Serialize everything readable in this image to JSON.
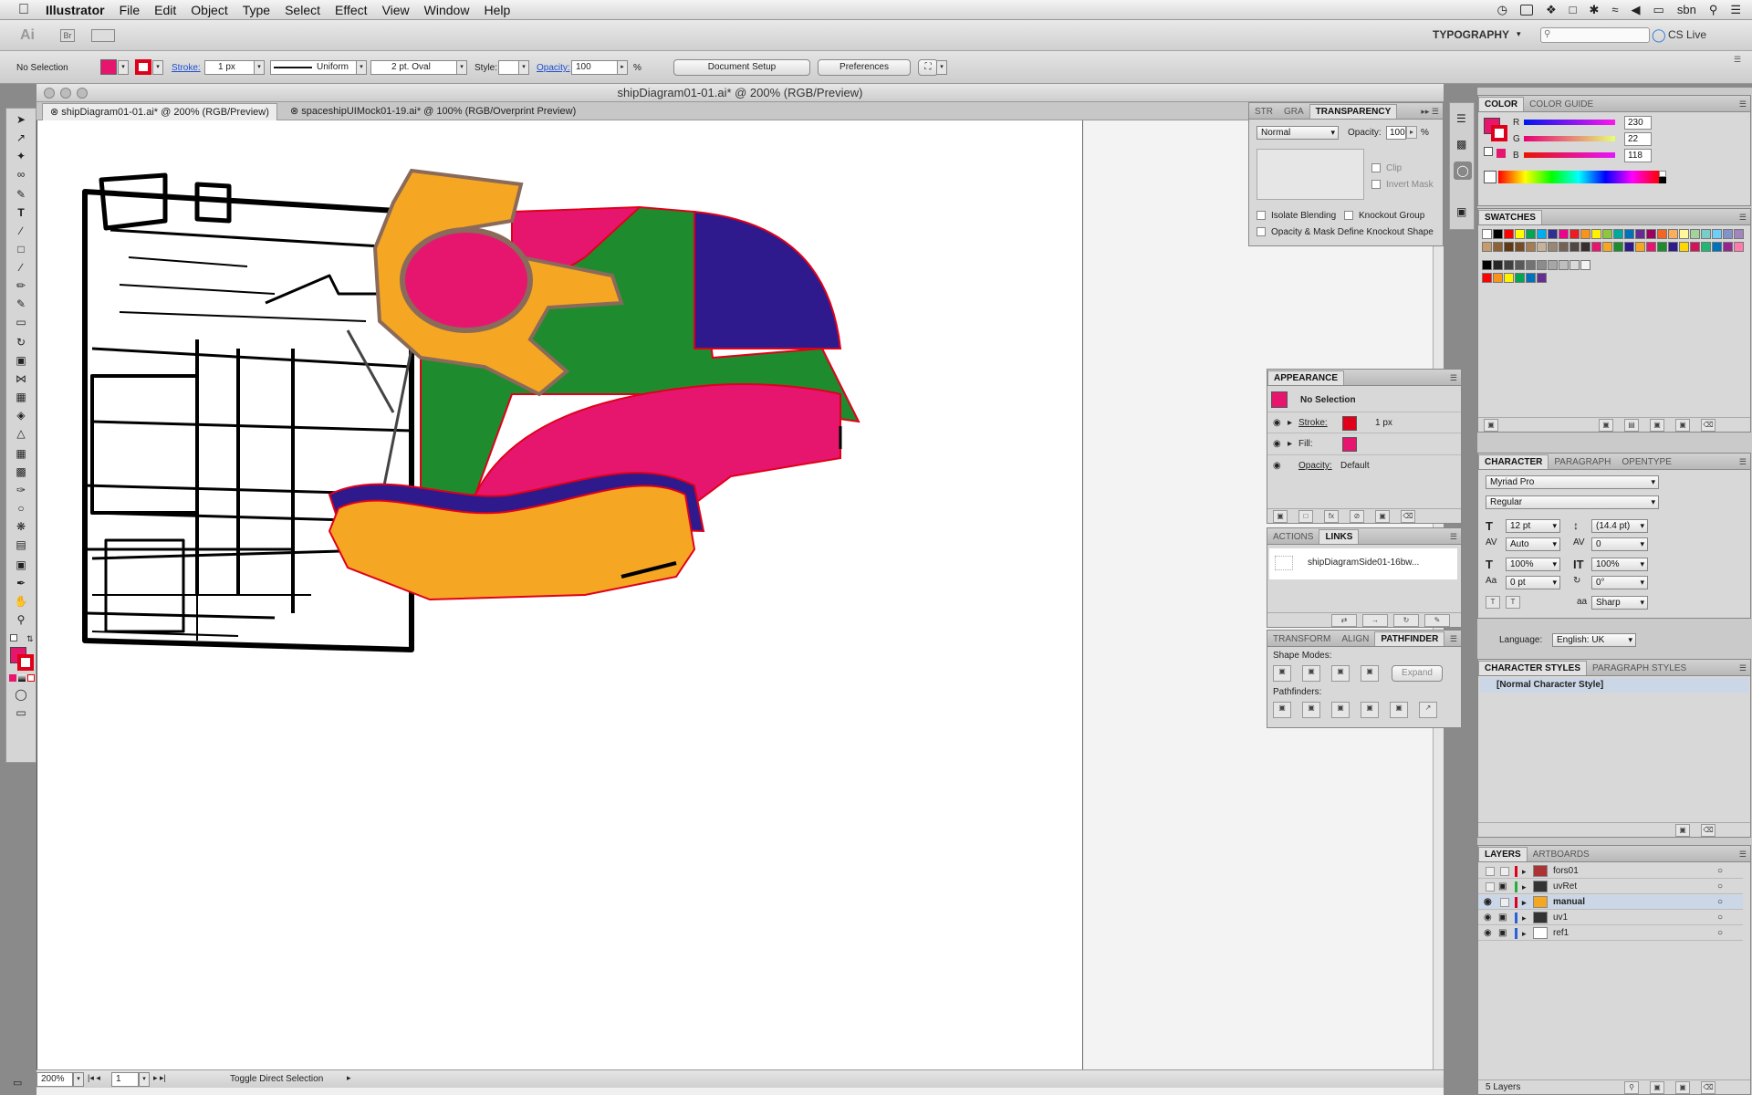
{
  "menubar": {
    "app_name": "Illustrator",
    "items": [
      "File",
      "Edit",
      "Object",
      "Type",
      "Select",
      "Effect",
      "View",
      "Window",
      "Help"
    ],
    "user": "sbn"
  },
  "appbar": {
    "app_logo": "Ai",
    "bridge": "Br",
    "workspace": "TYPOGRAPHY",
    "cs_live": "CS Live"
  },
  "control": {
    "selection": "No Selection",
    "stroke_label": "Stroke:",
    "stroke_value": "1 px",
    "profile": "Uniform",
    "brush": "2 pt. Oval",
    "style_label": "Style:",
    "opacity_label": "Opacity:",
    "opacity_value": "100",
    "percent": "%",
    "doc_setup": "Document Setup",
    "preferences": "Preferences"
  },
  "document": {
    "window_title": "shipDiagram01-01.ai* @ 200% (RGB/Preview)",
    "tabs": [
      "shipDiagram01-01.ai* @ 200% (RGB/Preview)",
      "spaceshipUIMock01-19.ai* @ 100% (RGB/Overprint Preview)"
    ],
    "zoom": "200%",
    "artboard": "1",
    "status": "Toggle Direct Selection"
  },
  "colors": {
    "fill": "#e6166f",
    "stroke": "#e0001a",
    "orange": "#f5a623",
    "green": "#1e8c2e",
    "purple": "#2e1a8c",
    "magenta": "#e6166f"
  },
  "transparency": {
    "tabs": [
      "STR",
      "GRA",
      "TRANSPARENCY"
    ],
    "blend_mode": "Normal",
    "opacity_label": "Opacity:",
    "opacity_value": "100",
    "percent": "%",
    "clip": "Clip",
    "invert_mask": "Invert Mask",
    "isolate": "Isolate Blending",
    "knockout": "Knockout Group",
    "opacity_mask": "Opacity & Mask Define Knockout Shape"
  },
  "appearance": {
    "title": "APPEARANCE",
    "selection": "No Selection",
    "stroke_label": "Stroke:",
    "stroke_value": "1 px",
    "fill_label": "Fill:",
    "opacity_label": "Opacity:",
    "opacity_value": "Default"
  },
  "links": {
    "tabs": [
      "ACTIONS",
      "LINKS"
    ],
    "item": "shipDiagramSide01-16bw..."
  },
  "pathfinder": {
    "tabs": [
      "TRANSFORM",
      "ALIGN",
      "PATHFINDER"
    ],
    "shape_modes": "Shape Modes:",
    "expand": "Expand",
    "pathfinders": "Pathfinders:"
  },
  "color_panel": {
    "tabs": [
      "COLOR",
      "COLOR GUIDE"
    ],
    "r_label": "R",
    "r": "230",
    "g_label": "G",
    "g": "22",
    "b_label": "B",
    "b": "118"
  },
  "swatches": {
    "title": "SWATCHES",
    "row1": [
      "#ffffff",
      "#000000",
      "#ff0000",
      "#ffff00",
      "#00a651",
      "#00aeef",
      "#2e3192",
      "#ec008c",
      "#ed1c24",
      "#f7941d",
      "#fff200",
      "#8dc63f",
      "#00a99d",
      "#0072bc",
      "#662d91",
      "#9e005d",
      "#f26522",
      "#fbaf5d",
      "#fff799",
      "#a3d39c",
      "#7accc8",
      "#6dcff6",
      "#8393ca",
      "#a186be"
    ],
    "row2": [
      "#c69c6d",
      "#8c6239",
      "#603813",
      "#754c24",
      "#a67c52",
      "#c7b299",
      "#998675",
      "#736357",
      "#534741",
      "#362f2d",
      "#e6166f",
      "#f5a623",
      "#1e8c2e",
      "#2e1a8c",
      "#f5a623",
      "#e6166f",
      "#1e8c2e",
      "#2e1a8c",
      "#ffd700",
      "#d4145a",
      "#22b573",
      "#0071bc",
      "#93278f",
      "#ff7bac"
    ],
    "grays": [
      "#000000",
      "#262626",
      "#404040",
      "#595959",
      "#737373",
      "#8c8c8c",
      "#a6a6a6",
      "#bfbfbf",
      "#d9d9d9",
      "#f2f2f2"
    ],
    "group": [
      "#ff0000",
      "#f7941d",
      "#fff200",
      "#00a651",
      "#0072bc",
      "#662d91"
    ]
  },
  "character": {
    "tabs": [
      "CHARACTER",
      "PARAGRAPH",
      "OPENTYPE"
    ],
    "font": "Myriad Pro",
    "style": "Regular",
    "size": "12 pt",
    "leading": "(14.4 pt)",
    "kerning": "Auto",
    "tracking": "0",
    "vscale": "100%",
    "hscale": "100%",
    "baseline": "0 pt",
    "rotation": "0°",
    "aa_label": "aa",
    "antialias": "Sharp",
    "language_label": "Language:",
    "language": "English: UK"
  },
  "char_styles": {
    "tabs": [
      "CHARACTER STYLES",
      "PARAGRAPH STYLES"
    ],
    "item": "[Normal Character Style]"
  },
  "layers": {
    "tabs": [
      "LAYERS",
      "ARTBOARDS"
    ],
    "items": [
      {
        "name": "fors01",
        "color": "#e0001a"
      },
      {
        "name": "uvRet",
        "color": "#27ae3a"
      },
      {
        "name": "manual",
        "color": "#e0001a"
      },
      {
        "name": "uv1",
        "color": "#2a62d6"
      },
      {
        "name": "ref1",
        "color": "#2a62d6"
      }
    ],
    "count": "5 Layers"
  }
}
